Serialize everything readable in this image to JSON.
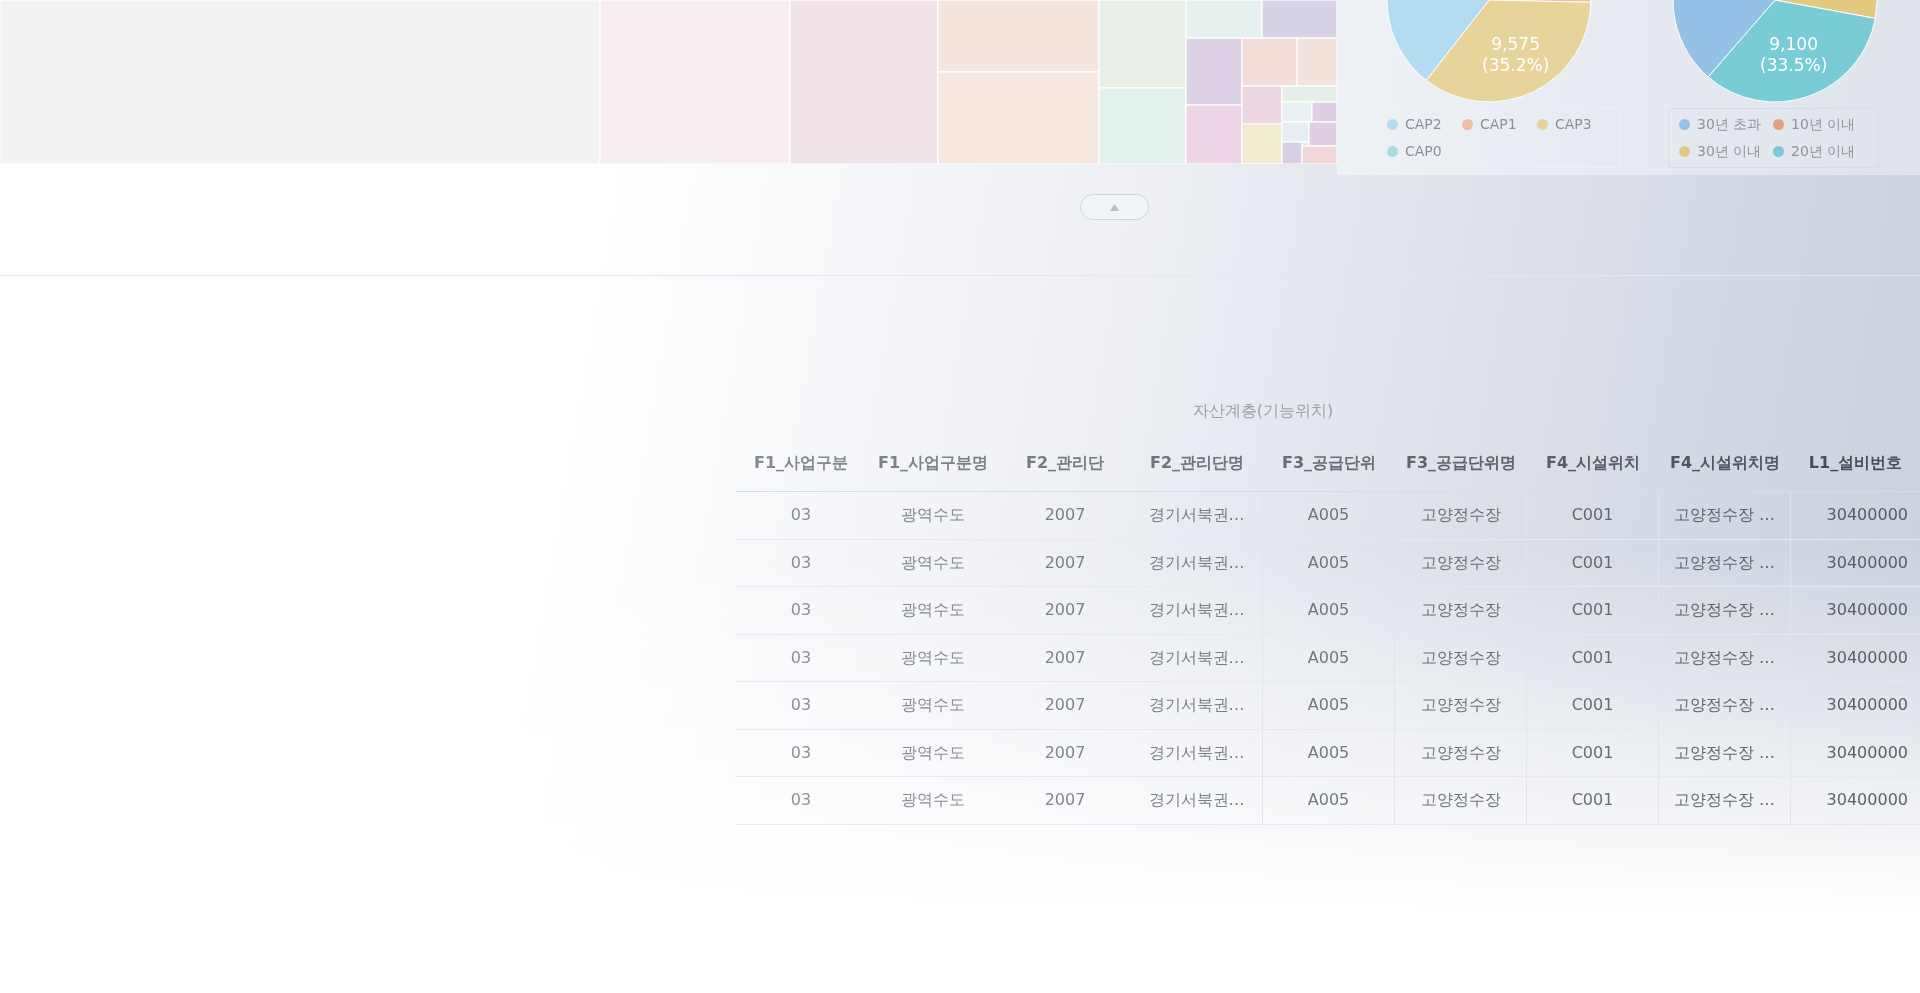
{
  "top_panel": {
    "pie_charts": [
      {
        "slice_label": {
          "value": "9,575",
          "share": "(35.2%)"
        },
        "legend": [
          {
            "label": "CAP2",
            "color": "#b3dcf0"
          },
          {
            "label": "CAP1",
            "color": "#f0bea6"
          },
          {
            "label": "CAP3",
            "color": "#e6d49a"
          },
          {
            "label": "CAP0",
            "color": "#a6dee4"
          }
        ]
      },
      {
        "slice_label": {
          "value": "9,100",
          "share": "(33.5%)"
        },
        "legend": [
          {
            "label": "30년 초과",
            "color": "#95c1e7"
          },
          {
            "label": "10년 이내",
            "color": "#e89f82"
          },
          {
            "label": "30년 이내",
            "color": "#e3c87f"
          },
          {
            "label": "20년 이내",
            "color": "#79ccd4"
          }
        ]
      }
    ]
  },
  "table": {
    "column_groups": [
      {
        "label": "자산계층(기능위치)",
        "columns": [
          "F1_사업구분",
          "F1_사업구분명",
          "F2_관리단",
          "F2_관리단명",
          "F3_공급단위",
          "F3_공급단위명",
          "F4_시설위치",
          "F4_시설위치명"
        ]
      },
      {
        "columns": [
          "L1_설비번호"
        ]
      }
    ],
    "rows": [
      [
        "03",
        "광역수도",
        "2007",
        "경기서북권…",
        "A005",
        "고양정수장",
        "C001",
        "고양정수장 …",
        "30400000"
      ],
      [
        "03",
        "광역수도",
        "2007",
        "경기서북권…",
        "A005",
        "고양정수장",
        "C001",
        "고양정수장 …",
        "30400000"
      ],
      [
        "03",
        "광역수도",
        "2007",
        "경기서북권…",
        "A005",
        "고양정수장",
        "C001",
        "고양정수장 …",
        "30400000"
      ],
      [
        "03",
        "광역수도",
        "2007",
        "경기서북권…",
        "A005",
        "고양정수장",
        "C001",
        "고양정수장 …",
        "30400000"
      ],
      [
        "03",
        "광역수도",
        "2007",
        "경기서북권…",
        "A005",
        "고양정수장",
        "C001",
        "고양정수장 …",
        "30400000"
      ],
      [
        "03",
        "광역수도",
        "2007",
        "경기서북권…",
        "A005",
        "고양정수장",
        "C001",
        "고양정수장 …",
        "30400000"
      ],
      [
        "03",
        "광역수도",
        "2007",
        "경기서북권…",
        "A005",
        "고양정수장",
        "C001",
        "고양정수장 …",
        "30400000"
      ]
    ]
  }
}
